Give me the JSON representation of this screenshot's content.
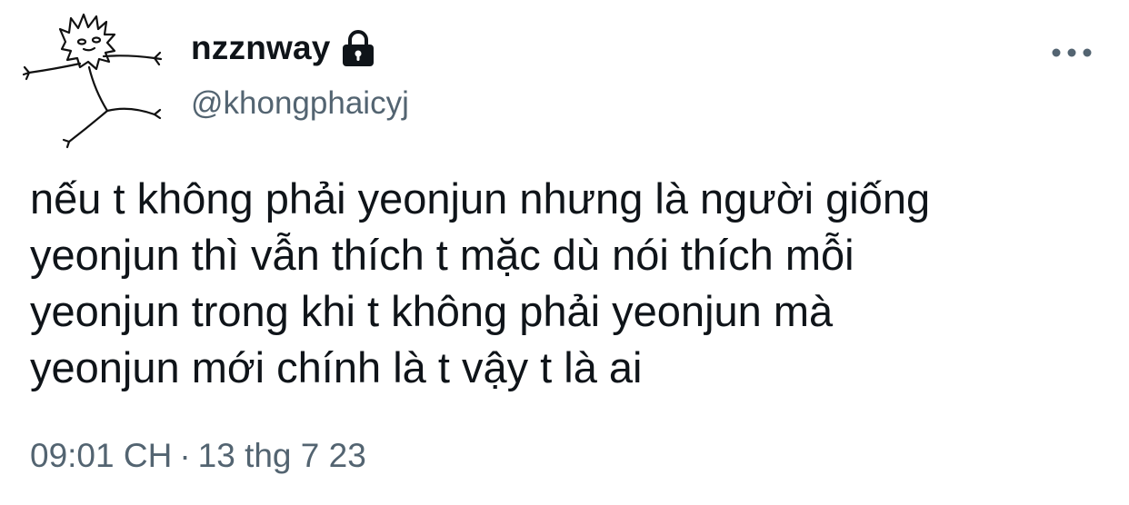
{
  "user": {
    "display_name": "nzznway",
    "handle": "@khongphaicyj",
    "protected_icon": "lock-icon",
    "avatar_icon": "stick-figure-avatar"
  },
  "tweet": {
    "text": "nếu t không phải yeonjun nhưng là người giống\nyeonjun thì vẫn thích t mặc dù nói thích mỗi\nyeonjun trong khi t không phải yeonjun mà\nyeonjun mới chính là t vậy t là ai",
    "time": "09:01 CH",
    "separator": "·",
    "date": "13 thg 7 23"
  },
  "actions": {
    "more_icon": "more-horizontal-icon"
  },
  "colors": {
    "text_primary": "#0f1419",
    "text_secondary": "#536471",
    "background": "#ffffff"
  }
}
